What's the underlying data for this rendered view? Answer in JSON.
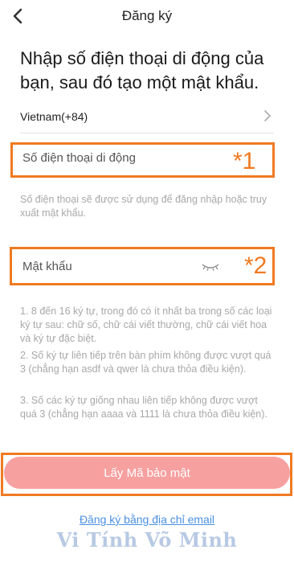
{
  "header": {
    "title": "Đăng ký"
  },
  "heading": "Nhập số điện thoại di động của bạn, sau đó tạo một mật khẩu.",
  "country": {
    "label": "Vietnam(+84)"
  },
  "phone": {
    "placeholder": "Số điện thoại di động",
    "marker": "*1",
    "hint": "Số điện thoại sẽ được sử dụng để đăng nhập hoặc truy xuất mật khẩu."
  },
  "password": {
    "placeholder": "Mật khẩu",
    "marker": "*2",
    "rules": [
      "1. 8 đến 16 ký tự, trong đó có ít nhất ba trong số các loại ký tự sau: chữ số, chữ cái viết thường, chữ cái viết hoa và ký tự đặc biệt.",
      "2. Số ký tự liên tiếp trên bàn phím không được vượt quá 3 (chẳng hạn asdf và qwer là chưa thỏa điều kiện).",
      "3. Số các ký tự giống nhau liên tiếp không được vượt quá 3 (chẳng hạn aaaa và 1111 là chưa thỏa điều kiện)."
    ]
  },
  "submit": {
    "label": "Lấy Mã bảo mật"
  },
  "email_link": "Đăng ký bằng địa chỉ email",
  "watermark": "Vi Tính Võ Minh",
  "colors": {
    "accent_outline": "#f07a22",
    "button_bg": "#f7a0a0",
    "link": "#4a90e2",
    "hint_text": "#a8a8a8"
  },
  "icons": {
    "back": "chevron-left-icon",
    "country_arrow": "chevron-right-icon",
    "password_visibility": "eye-closed-icon"
  }
}
